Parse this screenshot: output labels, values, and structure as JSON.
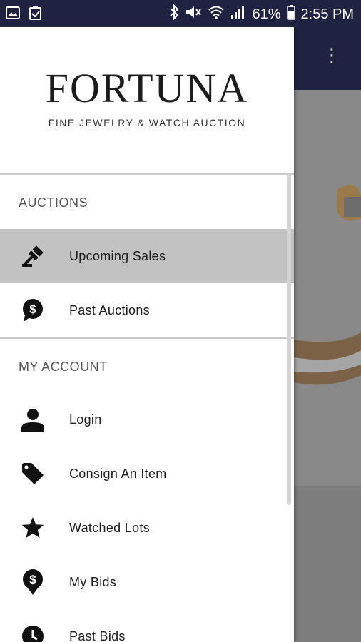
{
  "status_bar": {
    "battery": "61%",
    "time": "2:55 PM",
    "left_icons": [
      "gallery-icon",
      "task-check-icon"
    ],
    "right_icons": [
      "bluetooth-icon",
      "mute-icon",
      "wifi-icon",
      "signal-icon",
      "battery-icon"
    ]
  },
  "brand": {
    "title": "FORTUNA",
    "subtitle": "FINE JEWELRY & WATCH AUCTION"
  },
  "sections": {
    "auctions": {
      "heading": "AUCTIONS",
      "items": [
        {
          "label": "Upcoming Sales",
          "icon": "gavel-icon",
          "active": true
        },
        {
          "label": "Past Auctions",
          "icon": "dollar-bubble-icon",
          "active": false
        }
      ]
    },
    "account": {
      "heading": "MY ACCOUNT",
      "items": [
        {
          "label": "Login",
          "icon": "person-icon"
        },
        {
          "label": "Consign An Item",
          "icon": "tag-icon"
        },
        {
          "label": "Watched Lots",
          "icon": "star-icon"
        },
        {
          "label": "My Bids",
          "icon": "dollar-pin-icon"
        },
        {
          "label": "Past Bids",
          "icon": "clock-icon"
        }
      ]
    }
  },
  "colors": {
    "appbar": "#1f2240",
    "active_row": "#c2c2c2",
    "scrim": "#8e8e8e"
  }
}
